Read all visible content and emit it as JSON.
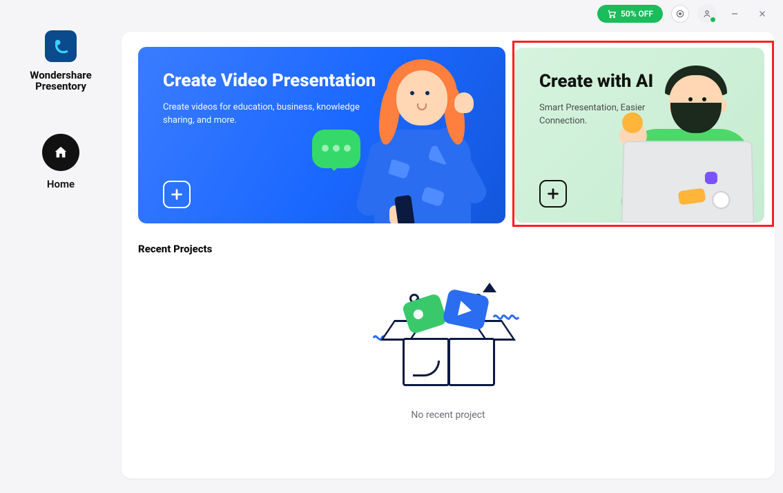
{
  "titlebar": {
    "discount_label": "50% OFF"
  },
  "brand": {
    "line1": "Wondershare",
    "line2": "Presentory"
  },
  "sidebar": {
    "home_label": "Home"
  },
  "cards": {
    "video": {
      "title": "Create Video Presentation",
      "desc": "Create videos for education, business, knowledge sharing, and more."
    },
    "ai": {
      "title": "Create with AI",
      "desc": "Smart Presentation, Easier Connection."
    }
  },
  "recent": {
    "title": "Recent Projects",
    "empty": "No recent project"
  }
}
